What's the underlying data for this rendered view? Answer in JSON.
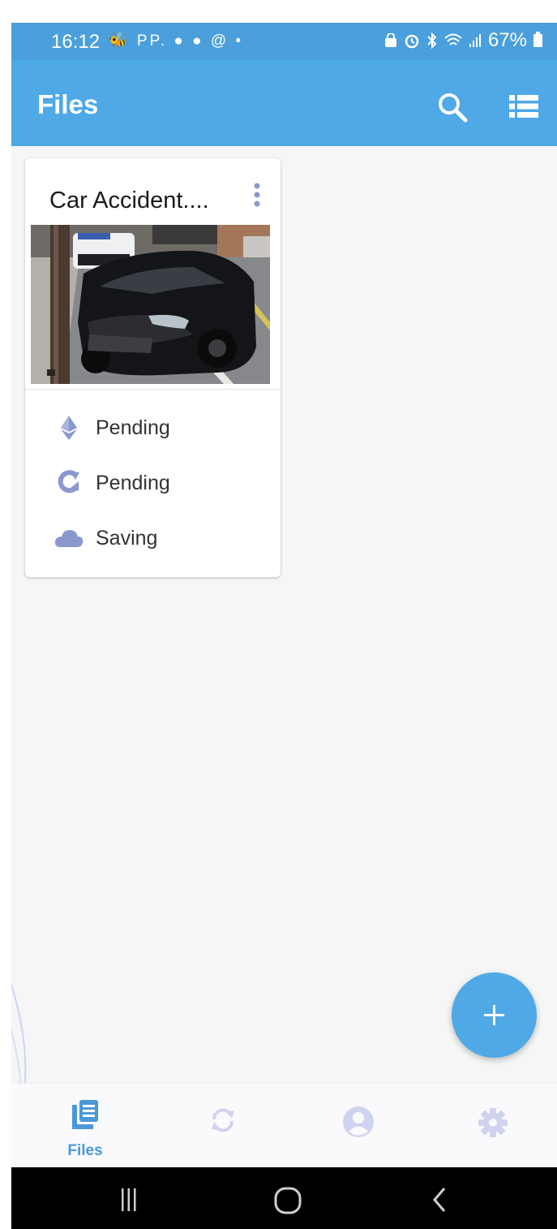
{
  "status_bar": {
    "time": "16:12",
    "left_icons": "🐝 PP. ● ● @ •",
    "battery_pct": "67%"
  },
  "app_bar": {
    "title": "Files",
    "icons": [
      "search-icon",
      "list-view-icon"
    ]
  },
  "file_card": {
    "title": "Car Accident....",
    "image": "wrecked black sedan against utility pole with police SUV behind",
    "statuses": [
      {
        "icon": "ethereum-icon",
        "label": "Pending"
      },
      {
        "icon": "sync-icon",
        "label": "Pending"
      },
      {
        "icon": "cloud-icon",
        "label": "Saving"
      }
    ]
  },
  "fab": {
    "icon": "plus-icon"
  },
  "bottom_nav": {
    "items": [
      {
        "icon": "files-icon",
        "label": "Files",
        "active": true
      },
      {
        "icon": "sync-icon",
        "label": "",
        "active": false
      },
      {
        "icon": "user-icon",
        "label": "",
        "active": false
      },
      {
        "icon": "gear-icon",
        "label": "",
        "active": false
      }
    ]
  },
  "system_nav": [
    "recent-apps-icon",
    "home-icon",
    "back-icon"
  ],
  "colors": {
    "app_bar": "#4ea9e6",
    "status_bar": "#4a9fdc",
    "accent": "#4a98d8",
    "status_icon": "#8b97cf",
    "inactive_nav_icon": "#cfd3ef"
  }
}
